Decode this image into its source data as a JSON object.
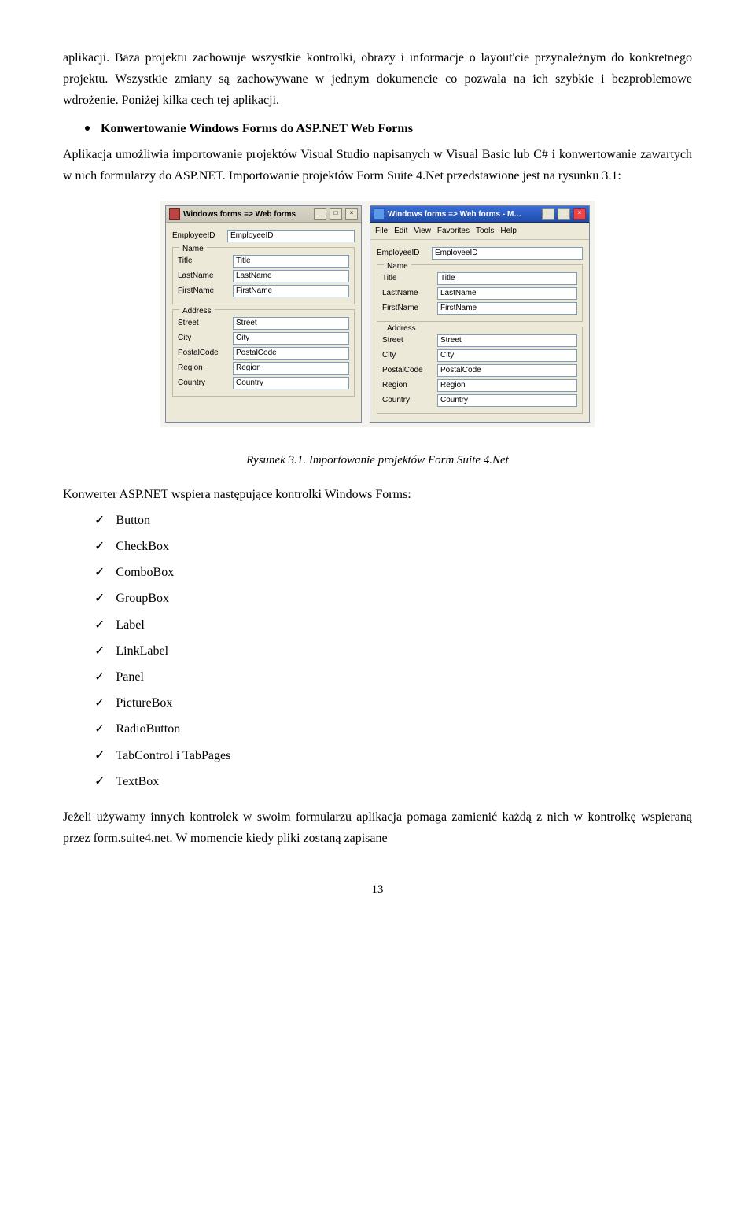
{
  "para1": "aplikacji. Baza projektu zachowuje wszystkie kontrolki, obrazy i informacje o layout'cie przynależnym do konkretnego projektu. Wszystkie zmiany są zachowywane w jednym dokumencie co pozwala na ich szybkie i bezproblemowe wdrożenie. Poniżej kilka cech tej aplikacji.",
  "bullet1": "Konwertowanie Windows Forms do ASP.NET Web Forms",
  "para2": "Aplikacja umożliwia importowanie projektów Visual Studio napisanych w  Visual Basic lub C#  i konwertowanie zawartych w nich formularzy do ASP.NET. Importowanie projektów Form Suite 4.Net przedstawione jest na rysunku 3.1:",
  "left_win": {
    "title": "Windows forms => Web forms",
    "top_row": {
      "lbl": "EmployeeID",
      "val": "EmployeeID"
    },
    "group_name": {
      "title": "Name",
      "rows": [
        {
          "lbl": "Title",
          "val": "Title"
        },
        {
          "lbl": "LastName",
          "val": "LastName"
        },
        {
          "lbl": "FirstName",
          "val": "FirstName"
        }
      ]
    },
    "group_addr": {
      "title": "Address",
      "rows": [
        {
          "lbl": "Street",
          "val": "Street"
        },
        {
          "lbl": "City",
          "val": "City"
        },
        {
          "lbl": "PostalCode",
          "val": "PostalCode"
        },
        {
          "lbl": "Region",
          "val": "Region"
        },
        {
          "lbl": "Country",
          "val": "Country"
        }
      ]
    }
  },
  "right_win": {
    "title": "Windows forms => Web forms - M…",
    "menu": [
      "File",
      "Edit",
      "View",
      "Favorites",
      "Tools",
      "Help"
    ],
    "top_row": {
      "lbl": "EmployeeID",
      "val": "EmployeeID"
    },
    "group_name": {
      "title": "Name",
      "rows": [
        {
          "lbl": "Title",
          "val": "Title"
        },
        {
          "lbl": "LastName",
          "val": "LastName"
        },
        {
          "lbl": "FirstName",
          "val": "FirstName"
        }
      ]
    },
    "group_addr": {
      "title": "Address",
      "rows": [
        {
          "lbl": "Street",
          "val": "Street"
        },
        {
          "lbl": "City",
          "val": "City"
        },
        {
          "lbl": "PostalCode",
          "val": "PostalCode"
        },
        {
          "lbl": "Region",
          "val": "Region"
        },
        {
          "lbl": "Country",
          "val": "Country"
        }
      ]
    }
  },
  "caption": "Rysunek 3.1. Importowanie projektów Form Suite 4.Net",
  "para3": "Konwerter ASP.NET wspiera następujące kontrolki Windows Forms:",
  "checklist": [
    "Button",
    "CheckBox",
    "ComboBox",
    "GroupBox",
    "Label",
    "LinkLabel",
    "Panel",
    "PictureBox",
    "RadioButton",
    "TabControl i TabPages",
    "TextBox"
  ],
  "para4": "Jeżeli używamy innych kontrolek w swoim formularzu aplikacja pomaga zamienić każdą z nich w kontrolkę wspieraną przez form.suite4.net. W momencie kiedy pliki zostaną zapisane",
  "page_number": "13"
}
